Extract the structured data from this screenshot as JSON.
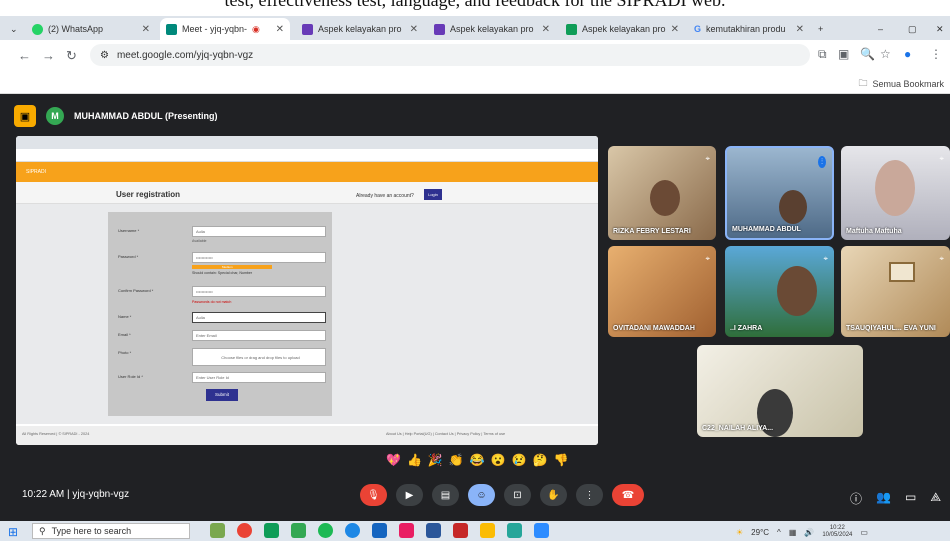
{
  "caption": "test, effectiveness test, language, and feedback for the SIPRADI web.",
  "tabs": [
    {
      "label": "(2) WhatsApp"
    },
    {
      "label": "Meet - yjq-yqbn-"
    },
    {
      "label": "Aspek kelayakan pro"
    },
    {
      "label": "Aspek kelayakan pro"
    },
    {
      "label": "Aspek kelayakan pro"
    },
    {
      "label": "kemutakhiran produ"
    }
  ],
  "url": "meet.google.com/yjq-yqbn-vgz",
  "bookmarks_folder": "Semua Bookmark",
  "presenter": {
    "initial": "M",
    "name": "MUHAMMAD ABDUL (Presenting)"
  },
  "shared": {
    "brand": "SIPRADI",
    "title": "User registration",
    "already": "Already have an account?",
    "login": "Login",
    "fields": [
      {
        "label": "Username *",
        "value": "Aulia",
        "hint": "Available"
      },
      {
        "label": "Password *",
        "value": "••••••••••••",
        "hint": ""
      },
      {
        "label": "Confirm Password *",
        "value": "••••••••••••",
        "hint": ""
      },
      {
        "label": "Name *",
        "value": "Aulia",
        "hint": ""
      },
      {
        "label": "Email *",
        "value": "Enter Email",
        "hint": ""
      },
      {
        "label": "Photo *",
        "value": "Choose files or drag and drop files to upload",
        "hint": ""
      },
      {
        "label": "User Role Id *",
        "value": "Enter User Role Id",
        "hint": ""
      }
    ],
    "strength": "Medium",
    "strength_note": "Should contain: Special char, Number",
    "error": "Passwords do not match",
    "submit": "Submit",
    "copyright": "All Rights Reserved | © SIPRADI - 2024",
    "links": "About Us | Help Portal(UG) | Contact Us | Privacy Policy | Terms of use"
  },
  "participants": [
    {
      "name": "RIZKA FEBRY LESTARI"
    },
    {
      "name": "MUHAMMAD ABDUL"
    },
    {
      "name": "Maftuha Maftuha"
    },
    {
      "name": "OVITADANI MAWADDAH"
    },
    {
      "name": "..I ZAHRA"
    },
    {
      "name": "TSAUQIYAHUL... EVA YUNI"
    },
    {
      "name": "C22_NAILAH ALIYA..."
    }
  ],
  "emojis": [
    "💖",
    "👍",
    "🎉",
    "👏",
    "😂",
    "😮",
    "😢",
    "🤔",
    "👎"
  ],
  "clock": "10:22 AM  |  yjq-yqbn-vgz",
  "taskbar": {
    "search": "Type here to search",
    "weather": "29°C",
    "time": "10:22",
    "date": "10/05/2024"
  },
  "colors": {
    "meet_bg": "#202124",
    "end_call": "#ea4335",
    "sipradi_orange": "#f7a21b",
    "sipradi_blue": "#2e3190"
  }
}
